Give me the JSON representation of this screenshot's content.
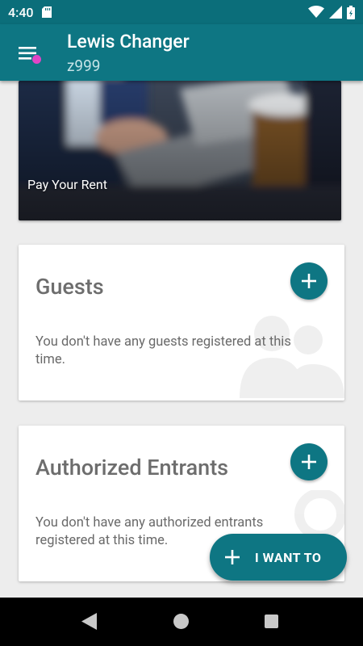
{
  "status_bar": {
    "time": "4:40",
    "icons": [
      "sd-card-icon",
      "wifi-icon",
      "cell-signal-icon",
      "battery-icon"
    ]
  },
  "app_bar": {
    "title": "Lewis Changer",
    "subtitle": "z999",
    "menu_icon": "hamburger-menu-icon",
    "notification_dot_color": "#e045c6"
  },
  "banner": {
    "label": "Pay Your Rent"
  },
  "guests_card": {
    "title": "Guests",
    "empty_text": "You don't have any guests registered at this time.",
    "add_icon": "plus-icon"
  },
  "entrants_card": {
    "title": "Authorized Entrants",
    "empty_text": "You don't have any authorized entrants registered at this time.",
    "add_icon": "plus-icon"
  },
  "fab": {
    "label": "I WANT TO",
    "icon": "plus-icon"
  },
  "nav_bar": {
    "icons": [
      "back-icon",
      "home-icon",
      "recents-icon"
    ]
  },
  "colors": {
    "primary": "#0e7683",
    "status_bar": "#0b6e7a",
    "background": "#ededed"
  }
}
